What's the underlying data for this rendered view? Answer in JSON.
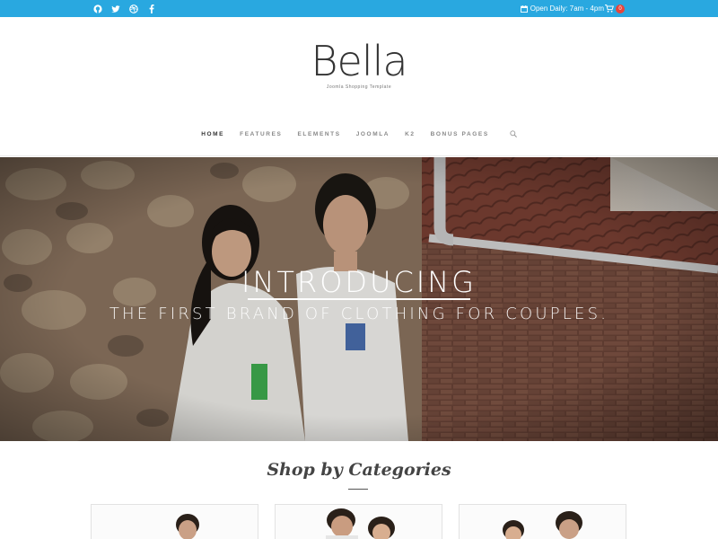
{
  "topbar": {
    "social_icons": [
      "github-icon",
      "twitter-icon",
      "dribbble-icon",
      "facebook-icon"
    ],
    "hours_text": "Open Daily: 7am - 4pm",
    "cart_count": "0",
    "accent_color": "#29a8e0"
  },
  "header": {
    "logo": "Bella",
    "tagline": "Joomla Shopping Template"
  },
  "nav": {
    "items": [
      {
        "label": "HOME",
        "active": true
      },
      {
        "label": "FEATURES"
      },
      {
        "label": "ELEMENTS"
      },
      {
        "label": "JOOMLA"
      },
      {
        "label": "K2"
      },
      {
        "label": "BONUS PAGES"
      }
    ],
    "search_icon": "search-icon"
  },
  "hero": {
    "title": "INTRODUCING",
    "subtitle": "THE FIRST BRAND OF CLOTHING FOR COUPLES."
  },
  "categories": {
    "title": "Shop by Categories",
    "cards": [
      "category-card-men",
      "category-card-couples",
      "category-card-women"
    ]
  }
}
